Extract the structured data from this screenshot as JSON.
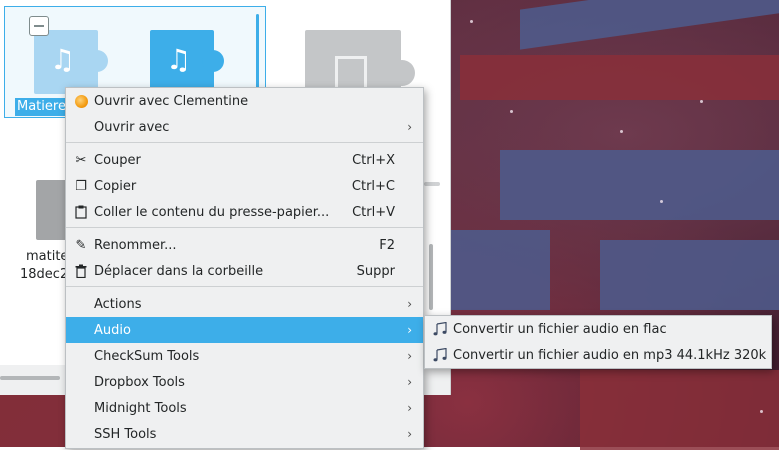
{
  "files": [
    {
      "label": "Matiere",
      "selected": true,
      "icon": "audio-file-icon"
    },
    {
      "label": "matite",
      "selected": false,
      "icon": "file-icon"
    },
    {
      "label": "18dec2",
      "selected": false,
      "icon": "file-icon"
    }
  ],
  "context_menu": {
    "items": [
      {
        "label": "Ouvrir avec Clementine",
        "icon": "clementine-icon"
      },
      {
        "label": "Ouvrir avec",
        "submenu": true
      },
      {
        "label": "Couper",
        "shortcut": "Ctrl+X",
        "icon": "scissors-icon"
      },
      {
        "label": "Copier",
        "shortcut": "Ctrl+C",
        "icon": "copy-icon"
      },
      {
        "label": "Coller le contenu du presse-papier...",
        "shortcut": "Ctrl+V",
        "icon": "paste-icon"
      },
      {
        "label": "Renommer...",
        "shortcut": "F2",
        "icon": "pencil-icon"
      },
      {
        "label": "Déplacer dans la corbeille",
        "shortcut": "Suppr",
        "icon": "trash-icon"
      },
      {
        "label": "Actions",
        "submenu": true
      },
      {
        "label": "Audio",
        "submenu": true,
        "active": true
      },
      {
        "label": "CheckSum Tools",
        "submenu": true
      },
      {
        "label": "Dropbox Tools",
        "submenu": true
      },
      {
        "label": "Midnight Tools",
        "submenu": true
      },
      {
        "label": "SSH Tools",
        "submenu": true
      }
    ]
  },
  "audio_submenu": {
    "items": [
      {
        "label": "Convertir un fichier audio en flac",
        "icon": "music-note-icon"
      },
      {
        "label": "Convertir un fichier audio en mp3 44.1kHz 320k",
        "icon": "music-note-icon"
      }
    ]
  },
  "glyphs": {
    "note": "♫",
    "submenu_arrow": "›",
    "scissors": "✂",
    "copy": "❐",
    "paste": "📋",
    "pencil": "✎",
    "trash": "🗑"
  },
  "colors": {
    "accent": "#3daee9",
    "menu_bg": "#eff0f1",
    "text": "#232627"
  }
}
